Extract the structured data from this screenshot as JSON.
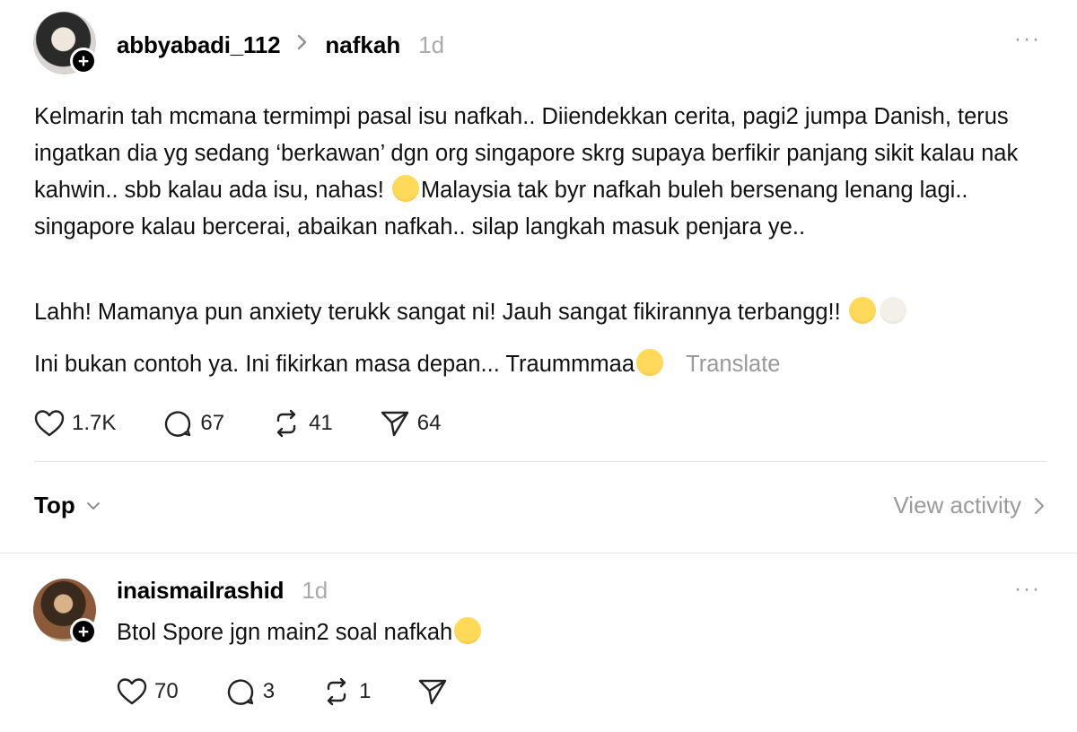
{
  "post": {
    "username": "abbyabadi_112",
    "topic": "nafkah",
    "time": "1d",
    "more_label": "···",
    "follow_badge": "+",
    "paragraph1": "Kelmarin tah mcmana termimpi pasal isu nafkah.. Diiendekkan cerita, pagi2 jumpa Danish, terus ingatkan dia yg sedang ‘berkawan’ dgn org singapore skrg supaya berfikir panjang sikit kalau nak kahwin.. sbb kalau ada isu, nahas!",
    "paragraph1_cont": "Malaysia tak byr nafkah buleh bersenang lenang lagi.. singapore kalau bercerai, abaikan nafkah.. silap langkah masuk penjara ye..",
    "paragraph2": "Lahh! Mamanya pun anxiety terukk sangat ni! Jauh sangat fikirannya terbangg!!",
    "paragraph3": "Ini bukan contoh ya. Ini fikirkan masa depan... Traummmaa",
    "translate_label": "Translate",
    "likes": "1.7K",
    "comments": "67",
    "reposts": "41",
    "shares": "64"
  },
  "sort": {
    "label": "Top",
    "view_activity": "View activity"
  },
  "reply": {
    "username": "inaismailrashid",
    "time": "1d",
    "more_label": "···",
    "follow_badge": "+",
    "text": "Btol Spore jgn main2 soal nafkah",
    "likes": "70",
    "comments": "3",
    "reposts": "1"
  },
  "icons": [
    "heart-icon",
    "comment-icon",
    "repost-icon",
    "share-icon",
    "chevron-down-icon",
    "chevron-right-icon",
    "more-icon",
    "plus-icon"
  ]
}
